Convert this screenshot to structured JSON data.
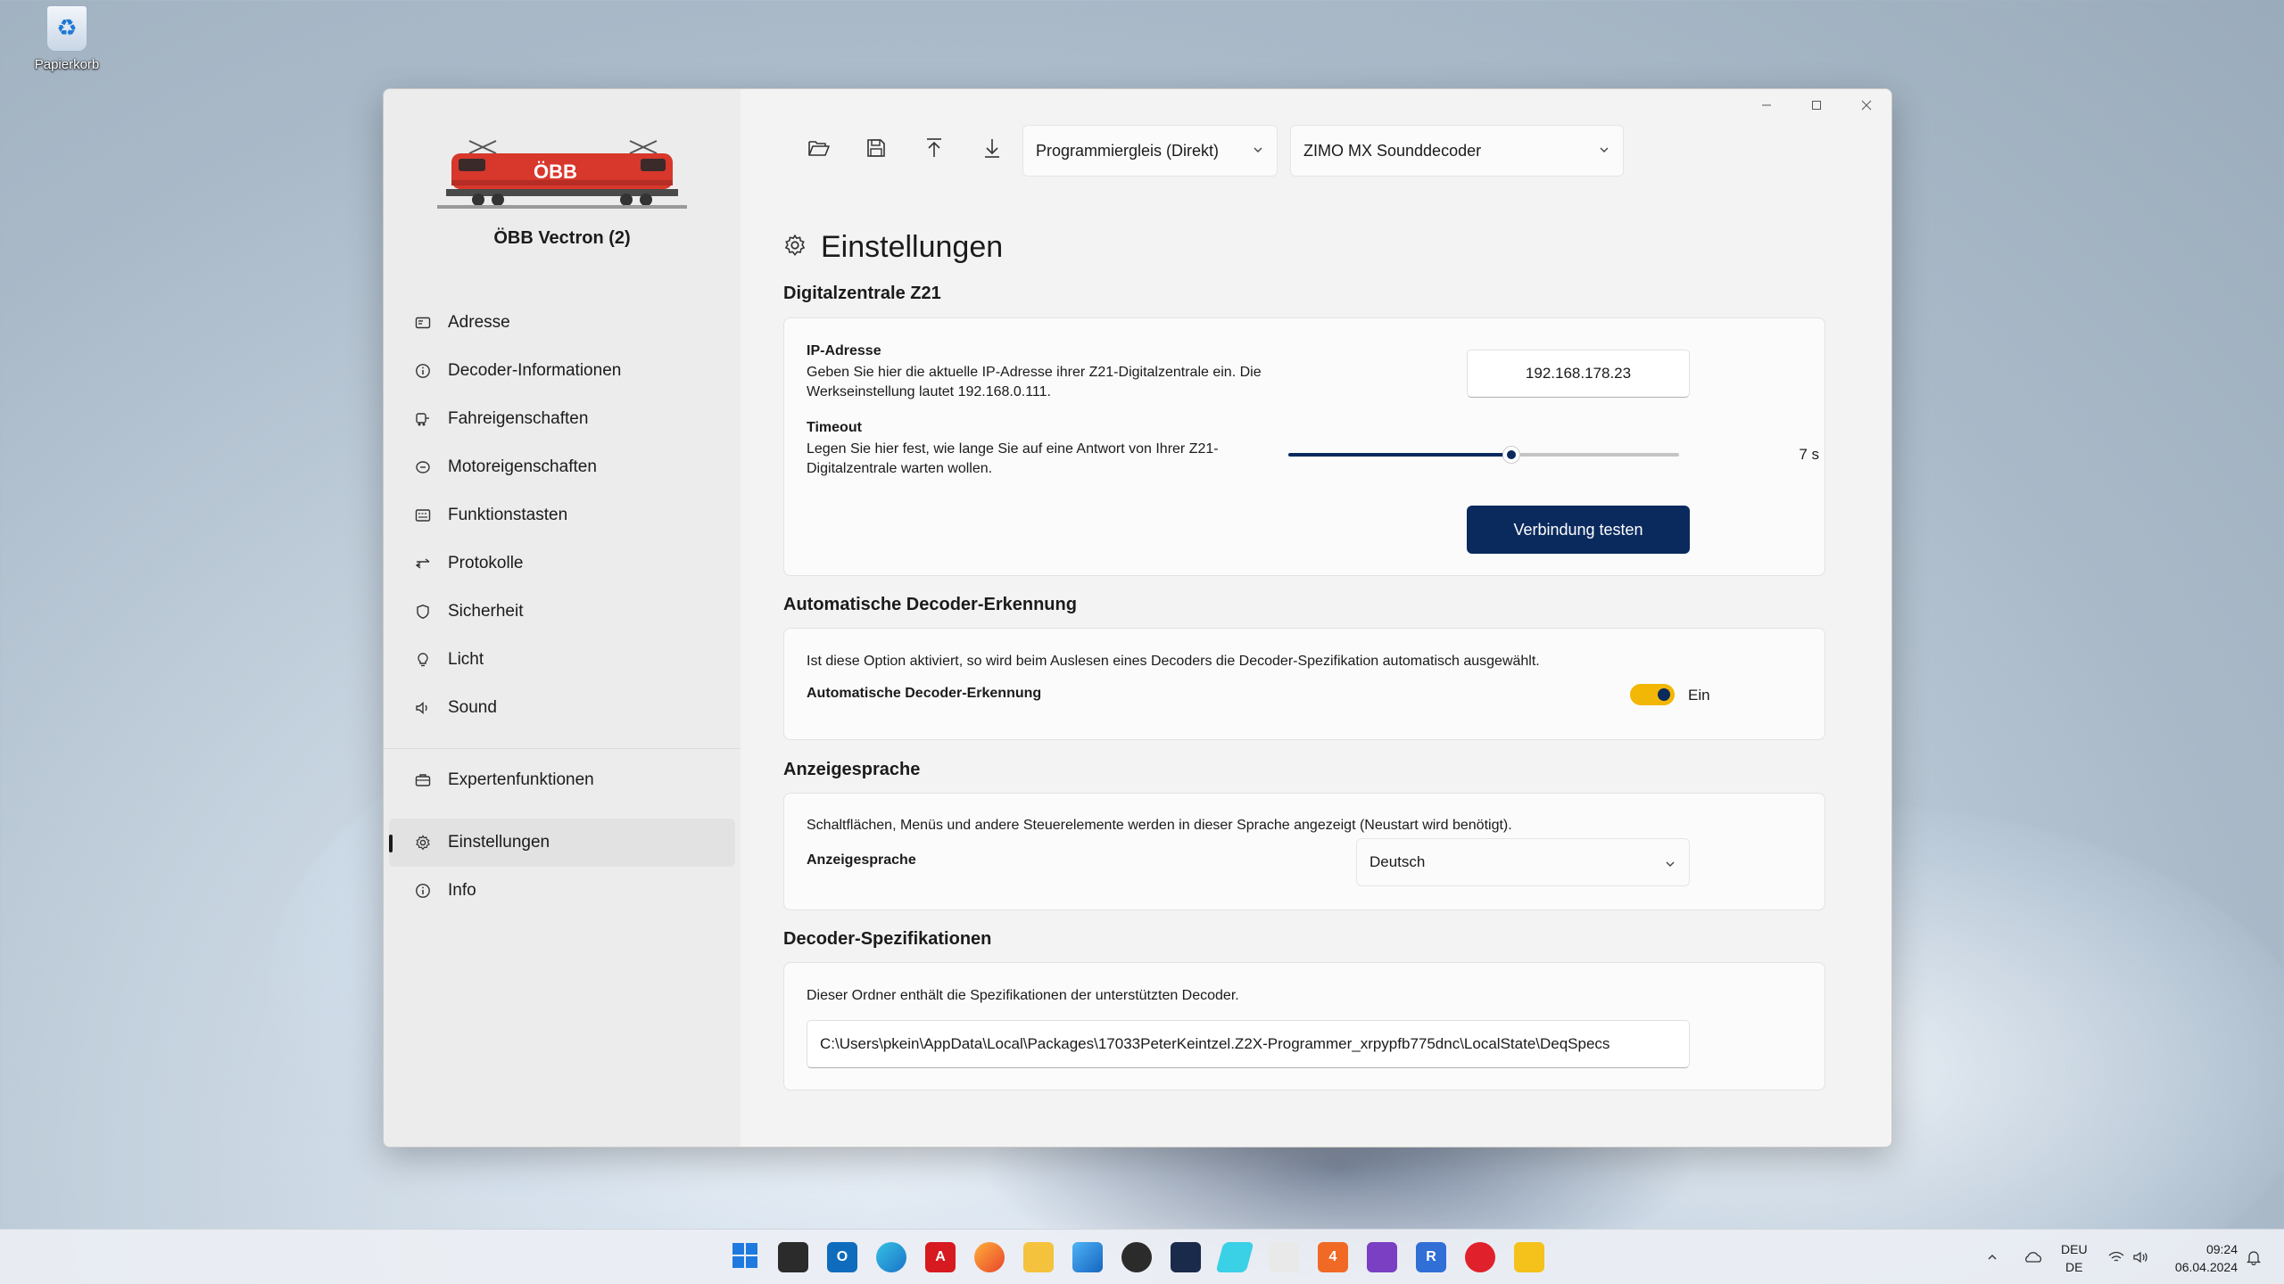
{
  "desktop": {
    "recycle_bin_label": "Papierkorb"
  },
  "sidebar": {
    "loco_name": "ÖBB Vectron (2)",
    "loco_brand": "ÖBB",
    "items": [
      {
        "label": "Adresse",
        "icon": "address-card-icon"
      },
      {
        "label": "Decoder-Informationen",
        "icon": "info-icon"
      },
      {
        "label": "Fahreigenschaften",
        "icon": "driving-icon"
      },
      {
        "label": "Motoreigenschaften",
        "icon": "motor-icon"
      },
      {
        "label": "Funktionstasten",
        "icon": "keyboard-icon"
      },
      {
        "label": "Protokolle",
        "icon": "arrows-icon"
      },
      {
        "label": "Sicherheit",
        "icon": "shield-icon"
      },
      {
        "label": "Licht",
        "icon": "lightbulb-icon"
      },
      {
        "label": "Sound",
        "icon": "speaker-icon"
      }
    ],
    "items2": [
      {
        "label": "Expertenfunktionen",
        "icon": "toolbox-icon"
      },
      {
        "label": "Einstellungen",
        "icon": "gear-icon",
        "active": true
      },
      {
        "label": "Info",
        "icon": "info-icon"
      }
    ]
  },
  "toolbar": {
    "track_mode": "Programmiergleis (Direkt)",
    "decoder_type": "ZIMO MX Sounddecoder"
  },
  "page": {
    "title": "Einstellungen"
  },
  "z21": {
    "section_title": "Digitalzentrale Z21",
    "ip_label": "IP-Adresse",
    "ip_desc": "Geben Sie hier die aktuelle IP-Adresse ihrer Z21-Digitalzentrale ein. Die Werkseinstellung lautet 192.168.0.111.",
    "ip_value": "192.168.178.23",
    "timeout_label": "Timeout",
    "timeout_desc": "Legen Sie hier fest, wie lange Sie auf eine Antwort von Ihrer Z21-Digitalzentrale warten wollen.",
    "timeout_value_text": "7 s",
    "timeout_fraction": 0.57,
    "test_button": "Verbindung testen"
  },
  "auto_detect": {
    "section_title": "Automatische Decoder-Erkennung",
    "desc": "Ist diese Option aktiviert, so wird beim Auslesen eines Decoders die Decoder-Spezifikation automatisch ausgewählt.",
    "label": "Automatische Decoder-Erkennung",
    "state": "Ein"
  },
  "language": {
    "section_title": "Anzeigesprache",
    "desc": "Schaltflächen, Menüs und andere Steuerelemente werden in dieser Sprache angezeigt (Neustart wird benötigt).",
    "label": "Anzeigesprache",
    "value": "Deutsch"
  },
  "specs": {
    "section_title": "Decoder-Spezifikationen",
    "desc": "Dieser Ordner enthält die Spezifikationen der unterstützten Decoder.",
    "path": "C:\\Users\\pkein\\AppData\\Local\\Packages\\17033PeterKeintzel.Z2X-Programmer_xrpypfb775dnc\\LocalState\\DeqSpecs"
  },
  "taskbar": {
    "lang_top": "DEU",
    "lang_bottom": "DE",
    "time": "09:24",
    "date": "06.04.2024",
    "apps": [
      "start-icon",
      "taskview-icon",
      "outlook-icon",
      "edge-icon",
      "acrobat-icon",
      "firefox-icon",
      "explorer-icon",
      "photos-icon",
      "whatsapp-icon",
      "app-icon",
      "app-icon",
      "app-icon",
      "app-icon",
      "visual-studio-icon",
      "app-icon",
      "media-icon",
      "z2x-programmer-icon"
    ]
  },
  "colors": {
    "accent": "#0a2a5e",
    "toggle": "#f2b705",
    "loco_red": "#d8372b"
  }
}
